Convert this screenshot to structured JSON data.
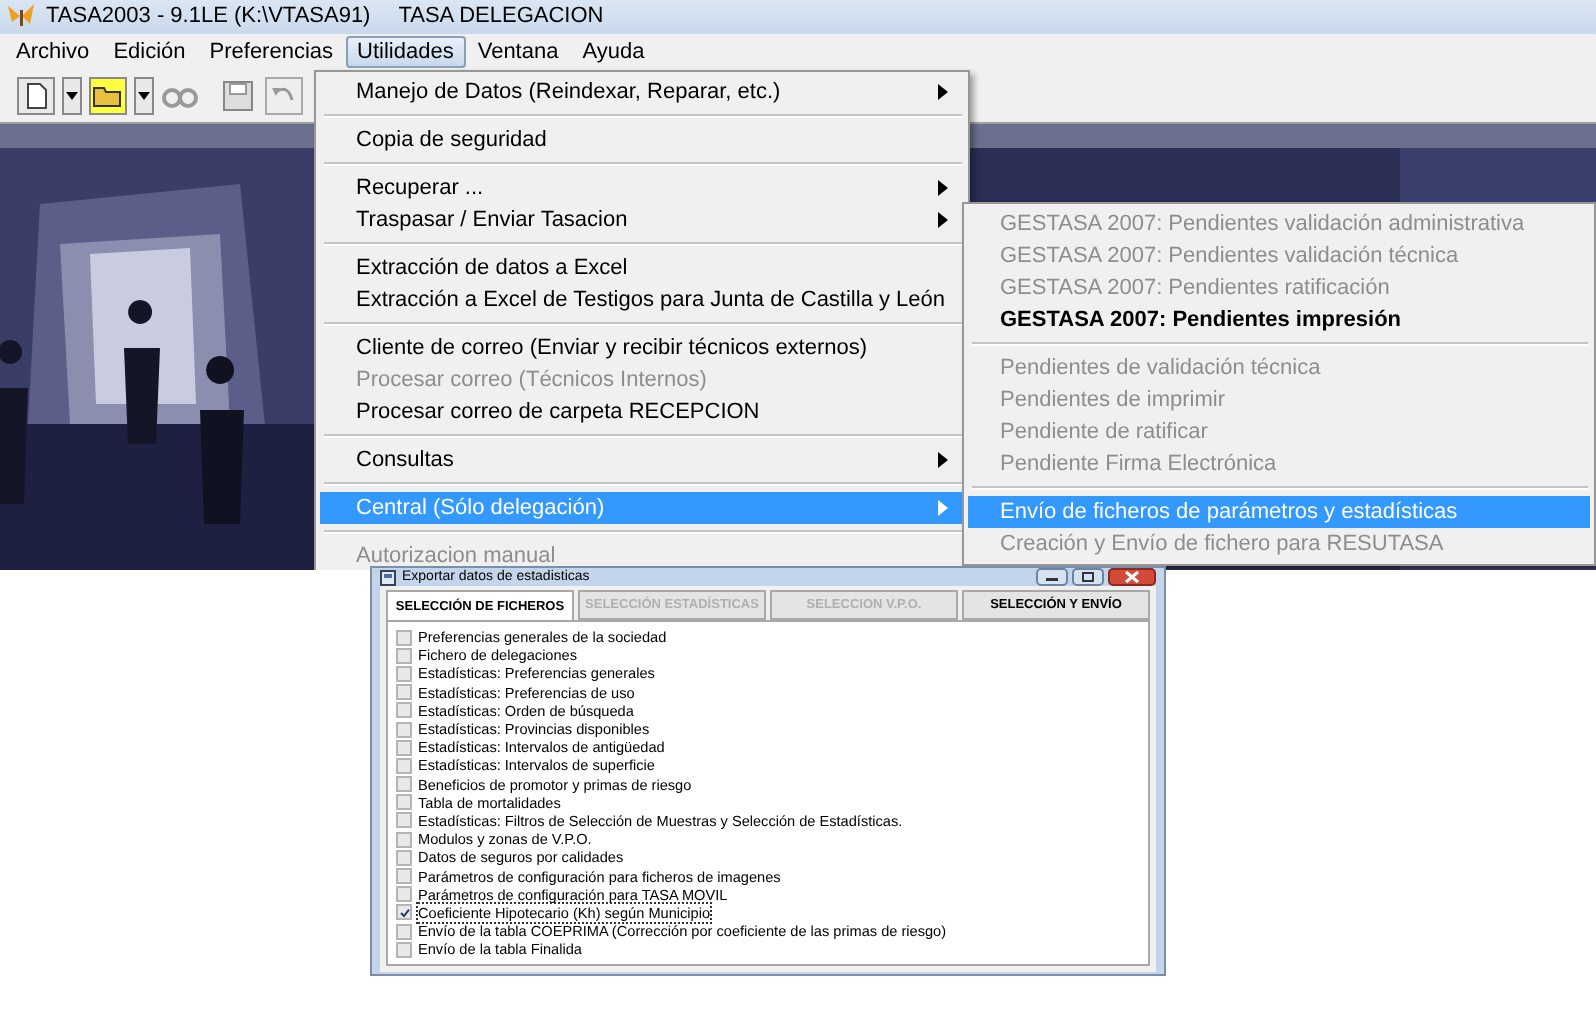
{
  "window": {
    "title": "TASA2003 - 9.1LE (K:\\VTASA91)",
    "subtitle": "TASA DELEGACION"
  },
  "menu_bar": [
    {
      "label": "Archivo",
      "selected": false
    },
    {
      "label": "Edición",
      "selected": false
    },
    {
      "label": "Preferencias",
      "selected": false
    },
    {
      "label": "Utilidades",
      "selected": true
    },
    {
      "label": "Ventana",
      "selected": false
    },
    {
      "label": "Ayuda",
      "selected": false
    }
  ],
  "utilidades_menu": {
    "groups": [
      [
        {
          "label": "Manejo de Datos (Reindexar, Reparar, etc.)",
          "disabled": false,
          "submenu": true,
          "selected": false
        }
      ],
      [
        {
          "label": "Copia de seguridad",
          "disabled": false,
          "submenu": false,
          "selected": false
        }
      ],
      [
        {
          "label": "Recuperar ...",
          "disabled": false,
          "submenu": true,
          "selected": false
        },
        {
          "label": "Traspasar / Enviar Tasacion",
          "disabled": false,
          "submenu": true,
          "selected": false
        }
      ],
      [
        {
          "label": "Extracción de datos a Excel",
          "disabled": false,
          "submenu": false,
          "selected": false
        },
        {
          "label": "Extracción a Excel de Testigos para Junta de Castilla y León",
          "disabled": false,
          "submenu": false,
          "selected": false
        }
      ],
      [
        {
          "label": "Cliente de correo (Enviar y recibir técnicos externos)",
          "disabled": false,
          "submenu": false,
          "selected": false
        },
        {
          "label": "Procesar correo (Técnicos Internos)",
          "disabled": true,
          "submenu": false,
          "selected": false
        },
        {
          "label": "Procesar correo de carpeta RECEPCION",
          "disabled": false,
          "submenu": false,
          "selected": false
        }
      ],
      [
        {
          "label": "Consultas",
          "disabled": false,
          "submenu": true,
          "selected": false
        }
      ],
      [
        {
          "label": "Central  (Sólo delegación)",
          "disabled": false,
          "submenu": true,
          "selected": true
        }
      ],
      [
        {
          "label": "Autorizacion manual",
          "disabled": true,
          "submenu": false,
          "selected": false
        }
      ]
    ]
  },
  "central_submenu": {
    "groups": [
      [
        {
          "label": "GESTASA 2007: Pendientes validación administrativa",
          "disabled": true,
          "emphasized": false,
          "selected": false
        },
        {
          "label": "GESTASA 2007: Pendientes validación técnica",
          "disabled": true,
          "emphasized": false,
          "selected": false
        },
        {
          "label": "GESTASA 2007: Pendientes ratificación",
          "disabled": true,
          "emphasized": false,
          "selected": false
        },
        {
          "label": "GESTASA 2007: Pendientes impresión",
          "disabled": false,
          "emphasized": true,
          "selected": false
        }
      ],
      [
        {
          "label": "Pendientes de validación técnica",
          "disabled": true,
          "emphasized": false,
          "selected": false
        },
        {
          "label": "Pendientes de imprimir",
          "disabled": true,
          "emphasized": false,
          "selected": false
        },
        {
          "label": "Pendiente de ratificar",
          "disabled": true,
          "emphasized": false,
          "selected": false
        },
        {
          "label": "Pendiente Firma Electrónica",
          "disabled": true,
          "emphasized": false,
          "selected": false
        }
      ],
      [
        {
          "label": "Envío de ficheros de parámetros y estadísticas",
          "disabled": false,
          "emphasized": false,
          "selected": true
        },
        {
          "label": "Creación y Envío de fichero para RESUTASA",
          "disabled": true,
          "emphasized": false,
          "selected": false
        }
      ]
    ]
  },
  "dialog": {
    "title": "Exportar datos de estadisticas",
    "tabs": [
      {
        "label": "SELECCIÓN DE FICHEROS",
        "selected": true,
        "disabled": false
      },
      {
        "label": "SELECCIÓN ESTADÍSTICAS",
        "selected": false,
        "disabled": true
      },
      {
        "label": "SELECCION V.P.O.",
        "selected": false,
        "disabled": true
      },
      {
        "label": "SELECCIÓN Y ENVÍO",
        "selected": false,
        "disabled": false
      }
    ],
    "items": [
      {
        "label": "Preferencias generales de la sociedad",
        "checked": false
      },
      {
        "label": "Fichero de delegaciones",
        "checked": false
      },
      {
        "label": "Estadísticas: Preferencias generales",
        "checked": false
      },
      {
        "label": "Estadísticas: Preferencias de uso",
        "checked": false
      },
      {
        "label": "Estadísticas: Orden de búsqueda",
        "checked": false
      },
      {
        "label": "Estadísticas: Provincias disponibles",
        "checked": false
      },
      {
        "label": "Estadísticas: Intervalos de antigüedad",
        "checked": false
      },
      {
        "label": "Estadísticas: Intervalos de superficie",
        "checked": false
      },
      {
        "label": "Beneficios de promotor y primas de riesgo",
        "checked": false
      },
      {
        "label": "Tabla de mortalidades",
        "checked": false
      },
      {
        "label": "Estadísticas: Filtros de Selección de Muestras y Selección de Estadísticas.",
        "checked": false
      },
      {
        "label": "Modulos y zonas de V.P.O.",
        "checked": false
      },
      {
        "label": "Datos de seguros por calidades",
        "checked": false
      },
      {
        "label": "Parámetros de configuración para ficheros de imagenes",
        "checked": false
      },
      {
        "label": "Parámetros de configuración para TASA MOVIL",
        "checked": false
      },
      {
        "label": "Coeficiente Hipotecario (Kh) según Municipio",
        "checked": true
      },
      {
        "label": "Envío de la tabla COEPRIMA (Corrección por coeficiente de las primas de riesgo)",
        "checked": false
      },
      {
        "label": "Envío de la tabla Finalida",
        "checked": false
      }
    ]
  }
}
